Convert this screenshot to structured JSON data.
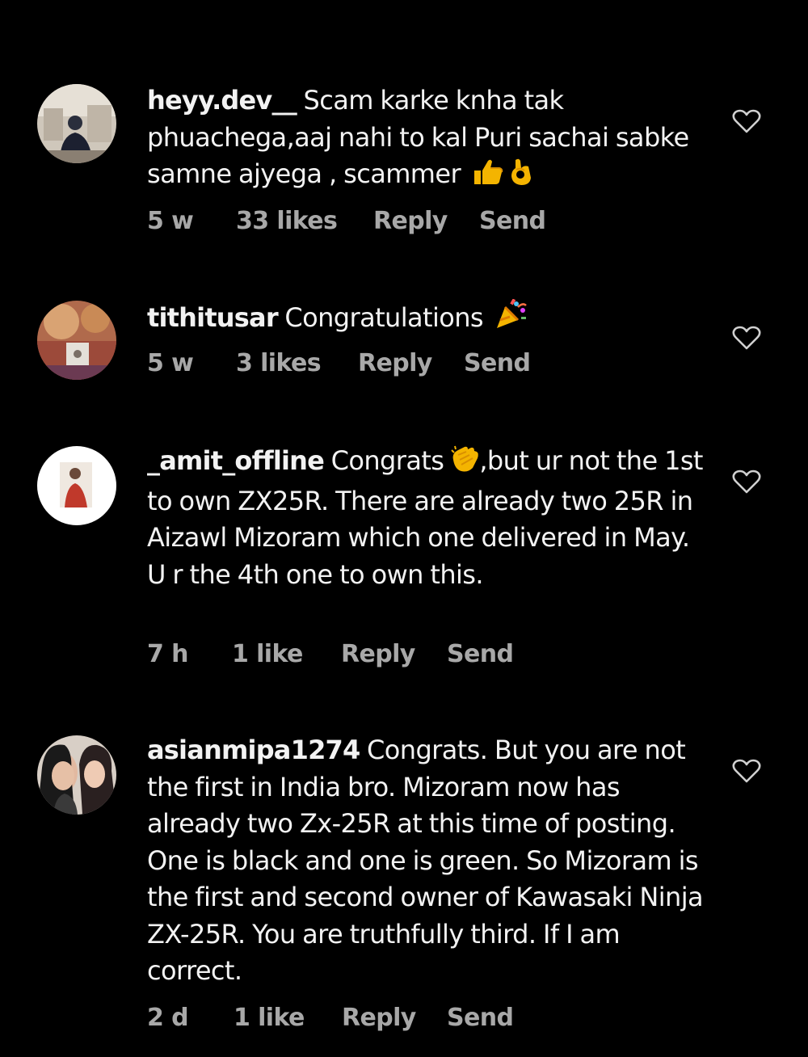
{
  "comments": [
    {
      "username": "heyy.dev__",
      "text": "Scam karke knha tak phuachega,aaj nahi to kal Puri sachai sabke samne ajyega , scammer",
      "emoji": [
        "thumbs-up-emoji",
        "ok-hand-emoji"
      ],
      "time": "5 w",
      "likes": "33 likes",
      "reply": "Reply",
      "send": "Send"
    },
    {
      "username": "tithitusar",
      "text": "Congratulations",
      "emoji": [
        "party-popper-emoji"
      ],
      "time": "5 w",
      "likes": "3 likes",
      "reply": "Reply",
      "send": "Send"
    },
    {
      "username": "_amit_offline",
      "text_before_emoji": "Congrats",
      "text_after_emoji": ",but ur not the 1st to own ZX25R. There are already two 25R in Aizawl Mizoram which one delivered in May. U r the 4th one to own this.",
      "emoji": [
        "clapping-hands-emoji"
      ],
      "time": "7 h",
      "likes": "1 like",
      "reply": "Reply",
      "send": "Send"
    },
    {
      "username": "asianmipa1274",
      "text": "Congrats. But you are not the first in India bro. Mizoram now has already two Zx-25R at this time of posting. One is black and one is green. So Mizoram is the first and second owner of Kawasaki Ninja ZX-25R. You are truthfully third. If I am correct.",
      "time": "2 d",
      "likes": "1 like",
      "reply": "Reply",
      "send": "Send"
    }
  ],
  "icons": {
    "like": "heart-outline-icon"
  },
  "colors": {
    "background": "#000000",
    "text": "#f2f2f2",
    "meta": "#a8a8a8"
  }
}
